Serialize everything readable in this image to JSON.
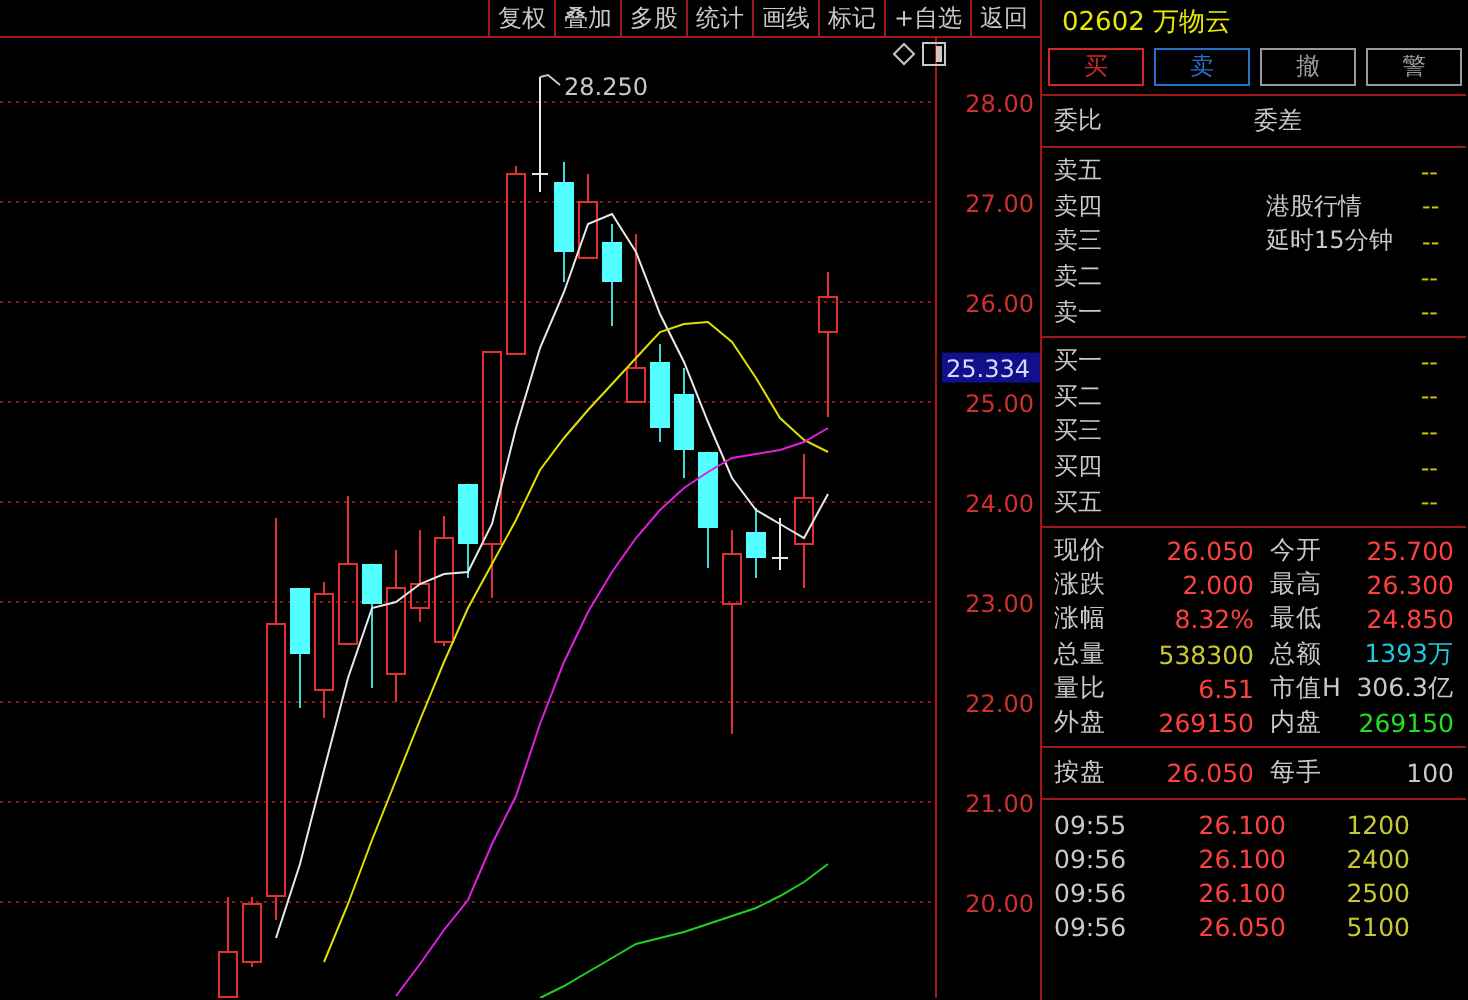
{
  "toolbar": {
    "buttons": [
      "复权",
      "叠加",
      "多股",
      "统计",
      "画线",
      "标记",
      "+自选",
      "返回"
    ]
  },
  "chart": {
    "chart_data": {
      "type": "candlestick",
      "grid": true,
      "categories": [
        null,
        null,
        null,
        null,
        null,
        null,
        null,
        null,
        null,
        null,
        null,
        null,
        null,
        null,
        null,
        null,
        null,
        null,
        null,
        null,
        null,
        null,
        null,
        null,
        null,
        null,
        null,
        null,
        null,
        null,
        null,
        null,
        null,
        null,
        null,
        null,
        null,
        null,
        null
      ],
      "ylim": [
        19.04,
        28.64
      ],
      "yticks": [
        {
          "value": 20,
          "label": "20.00"
        },
        {
          "value": 21,
          "label": "21.00"
        },
        {
          "value": 22,
          "label": "22.00"
        },
        {
          "value": 23,
          "label": "23.00"
        },
        {
          "value": 24,
          "label": "24.00"
        },
        {
          "value": 25,
          "label": "25.00"
        },
        {
          "value": 26,
          "label": "26.00"
        },
        {
          "value": 27,
          "label": "27.00"
        },
        {
          "value": 28,
          "label": "28.00"
        }
      ],
      "ohlc": [
        null,
        null,
        null,
        null,
        null,
        null,
        null,
        null,
        null,
        [
          19.05,
          20.05,
          19.0,
          19.5
        ],
        [
          19.4,
          20.05,
          19.35,
          19.98
        ],
        [
          20.06,
          23.84,
          19.82,
          22.78
        ],
        [
          23.14,
          23.14,
          21.94,
          22.48
        ],
        [
          22.12,
          23.2,
          21.84,
          23.08
        ],
        [
          22.58,
          24.06,
          22.58,
          23.38
        ],
        [
          23.38,
          23.38,
          22.14,
          22.98
        ],
        [
          22.28,
          23.52,
          22.0,
          23.14
        ],
        [
          22.94,
          23.72,
          22.8,
          23.18
        ],
        [
          22.6,
          23.86,
          22.56,
          23.64
        ],
        [
          24.18,
          24.18,
          23.24,
          23.58
        ],
        [
          23.58,
          25.5,
          23.04,
          25.5
        ],
        [
          25.48,
          27.36,
          25.48,
          27.28
        ],
        [
          27.28,
          28.25,
          27.1,
          27.28
        ],
        [
          27.2,
          27.4,
          26.2,
          26.5
        ],
        [
          26.44,
          27.28,
          26.44,
          27.0
        ],
        [
          26.6,
          26.78,
          25.76,
          26.2
        ],
        [
          25.0,
          26.68,
          25.0,
          25.34
        ],
        [
          25.4,
          25.58,
          24.6,
          24.74
        ],
        [
          25.08,
          25.34,
          24.24,
          24.52
        ],
        [
          24.5,
          24.5,
          23.34,
          23.74
        ],
        [
          22.98,
          23.72,
          21.68,
          23.48
        ],
        [
          23.7,
          23.94,
          23.24,
          23.44
        ],
        [
          23.44,
          23.84,
          23.32,
          23.44
        ],
        [
          23.58,
          24.48,
          23.14,
          24.04
        ],
        [
          25.7,
          26.3,
          24.85,
          26.05
        ],
        null,
        null,
        null,
        null
      ],
      "series": [
        {
          "type": "line",
          "color": "#e8e8e8",
          "values": [
            null,
            null,
            null,
            null,
            null,
            null,
            null,
            null,
            null,
            null,
            null,
            19.64,
            20.38,
            21.32,
            22.24,
            22.94,
            23.0,
            23.18,
            23.28,
            23.3,
            23.78,
            24.74,
            25.54,
            26.1,
            26.78,
            26.88,
            26.5,
            25.88,
            25.4,
            24.8,
            24.24,
            23.92,
            23.78,
            23.64,
            24.08,
            null,
            null,
            null,
            null
          ]
        },
        {
          "type": "line",
          "color": "#e0e000",
          "values": [
            null,
            null,
            null,
            null,
            null,
            null,
            null,
            null,
            null,
            null,
            null,
            null,
            null,
            19.4,
            19.98,
            20.62,
            21.22,
            21.82,
            22.4,
            22.94,
            23.38,
            23.82,
            24.32,
            24.64,
            24.92,
            25.18,
            25.44,
            25.7,
            25.78,
            25.8,
            25.6,
            25.24,
            24.84,
            24.62,
            24.5,
            null,
            null,
            null,
            null
          ]
        },
        {
          "type": "line",
          "color": "#e020e0",
          "values": [
            null,
            null,
            null,
            null,
            null,
            null,
            null,
            null,
            null,
            null,
            null,
            null,
            null,
            null,
            null,
            null,
            19.06,
            19.38,
            19.72,
            20.02,
            20.58,
            21.06,
            21.78,
            22.4,
            22.9,
            23.3,
            23.64,
            23.92,
            24.14,
            24.3,
            24.44,
            24.48,
            24.52,
            24.6,
            24.74,
            null,
            null,
            null,
            null
          ]
        },
        {
          "type": "line",
          "color": "#20d020",
          "values": [
            null,
            null,
            null,
            null,
            null,
            null,
            null,
            null,
            null,
            null,
            null,
            null,
            null,
            null,
            null,
            null,
            null,
            null,
            null,
            null,
            null,
            null,
            19.04,
            19.16,
            19.3,
            19.44,
            19.58,
            19.64,
            19.7,
            19.78,
            19.86,
            19.94,
            20.06,
            20.2,
            20.38,
            null,
            null,
            null,
            null
          ]
        }
      ]
    },
    "high_label": "28.250",
    "price_marker": "25.334"
  },
  "quote": {
    "code": "02602",
    "name": "万物云",
    "trade_buttons": [
      {
        "label": "买",
        "color": "#d02828"
      },
      {
        "label": "卖",
        "color": "#2a70c8"
      },
      {
        "label": "撤",
        "color": "#9a9a9a"
      },
      {
        "label": "警",
        "color": "#9a9a9a"
      }
    ],
    "order_header": [
      "委比",
      "委差"
    ],
    "asks": [
      {
        "label": "卖五",
        "value": "--"
      },
      {
        "label": "卖四",
        "note": "港股行情",
        "value": "--"
      },
      {
        "label": "卖三",
        "note": "延时15分钟",
        "value": "--"
      },
      {
        "label": "卖二",
        "value": "--"
      },
      {
        "label": "卖一",
        "value": "--"
      }
    ],
    "bids": [
      {
        "label": "买一",
        "value": "--"
      },
      {
        "label": "买二",
        "value": "--"
      },
      {
        "label": "买三",
        "value": "--"
      },
      {
        "label": "买四",
        "value": "--"
      },
      {
        "label": "买五",
        "value": "--"
      }
    ],
    "stats": [
      {
        "label": "现价",
        "value": "26.050",
        "color": "#ff4040"
      },
      {
        "label": "今开",
        "value": "25.700",
        "color": "#ff4040"
      },
      {
        "label": "涨跌",
        "value": "2.000",
        "color": "#ff4040"
      },
      {
        "label": "最高",
        "value": "26.300",
        "color": "#ff4040"
      },
      {
        "label": "涨幅",
        "value": "8.32%",
        "color": "#ff4040"
      },
      {
        "label": "最低",
        "value": "24.850",
        "color": "#ff4040"
      },
      {
        "label": "总量",
        "value": "538300",
        "color": "#c8c832"
      },
      {
        "label": "总额",
        "value": "1393万",
        "color": "#20c8e0"
      },
      {
        "label": "量比",
        "value": "6.51",
        "color": "#ff4040"
      },
      {
        "label": "市值H",
        "value": "306.3亿",
        "color": "#c8c8c8"
      },
      {
        "label": "外盘",
        "value": "269150",
        "color": "#ff4040"
      },
      {
        "label": "内盘",
        "value": "269150",
        "color": "#20e020"
      }
    ],
    "lot": [
      {
        "label": "按盘",
        "value": "26.050",
        "color": "#ff4040"
      },
      {
        "label": "每手",
        "value": "100",
        "color": "#c8c8c8"
      }
    ],
    "trades": [
      {
        "time": "09:55",
        "price": "26.100",
        "volume": "1200"
      },
      {
        "time": "09:56",
        "price": "26.100",
        "volume": "2400"
      },
      {
        "time": "09:56",
        "price": "26.100",
        "volume": "2500"
      },
      {
        "time": "09:56",
        "price": "26.050",
        "volume": "5100"
      }
    ]
  }
}
